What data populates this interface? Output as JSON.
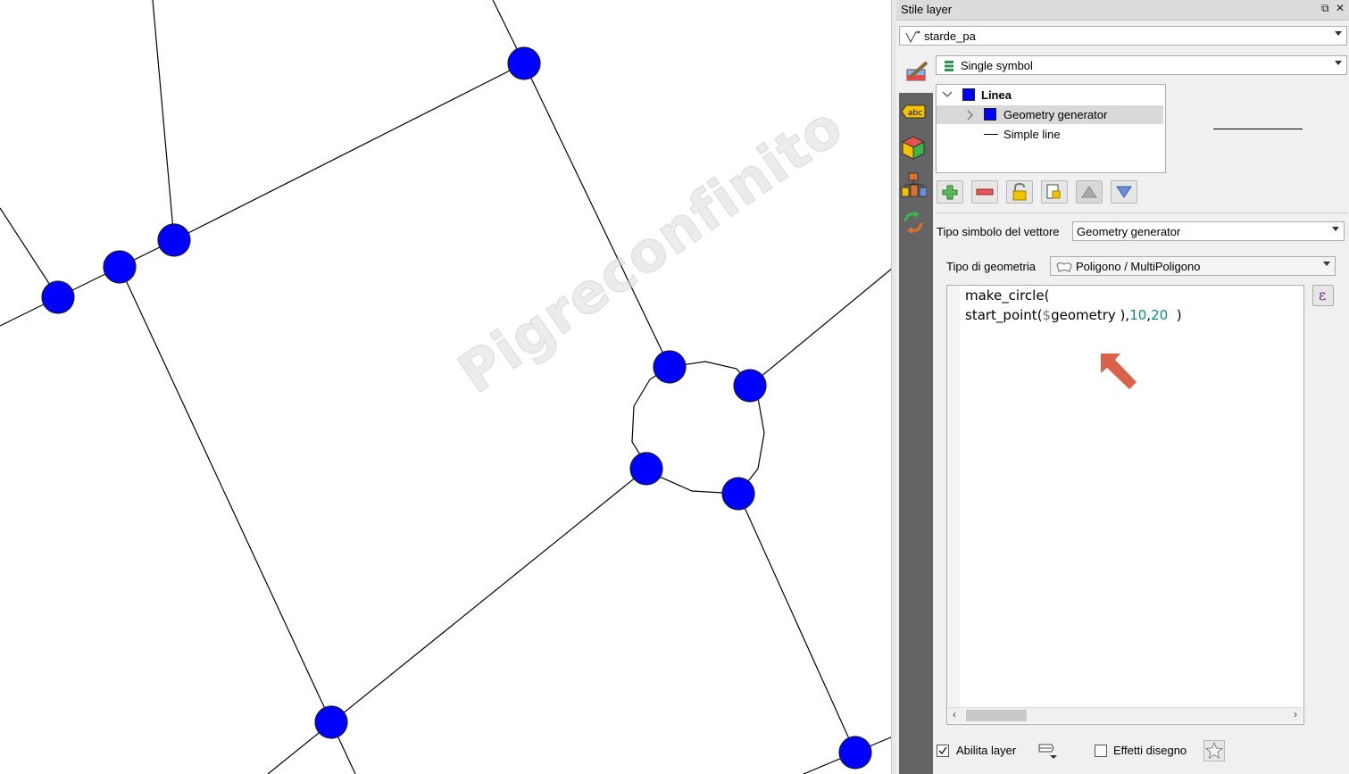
{
  "map": {
    "watermark": "Pigreconfinito",
    "line_color": "#000000",
    "node_color": "#0000ff"
  },
  "panel": {
    "title": "Stile layer",
    "float_icon": "restore-icon",
    "close_icon": "close-icon",
    "layer_combo": {
      "value": "starde_pa",
      "icon": "line-layer-icon"
    },
    "renderer_combo": {
      "value": "Single symbol",
      "icon": "single-symbol-icon"
    },
    "sidebar_icons": [
      "symbology-brush-icon",
      "labels-abc-icon",
      "3d-view-icon",
      "diagrams-icon",
      "history-icon"
    ],
    "labels_icon_text": "abc",
    "tree": {
      "root": "Linea",
      "child_1": "Geometry generator",
      "child_2": "Simple line",
      "swatch_color": "#0000ff"
    },
    "toolbar_icons": [
      "add-symbol-layer-icon",
      "remove-symbol-layer-icon",
      "lock-color-icon",
      "duplicate-symbol-layer-icon",
      "move-up-icon",
      "move-down-icon"
    ],
    "symbol_type": {
      "label": "Tipo simbolo del vettore",
      "value": "Geometry generator"
    },
    "geometry_type": {
      "label": "Tipo di geometria",
      "value": "Poligono / MultiPoligono",
      "icon": "polygon-icon"
    },
    "expression": {
      "line1": "make_circle(",
      "line2_a": "start_point(",
      "line2_var": "$",
      "line2_b": "geometry ),",
      "line2_n1": "10",
      "line2_c": ",",
      "line2_n2": "20",
      "line2_d": "  )"
    },
    "expression_button": "ε",
    "arrow_color": "#d9634a",
    "footer": {
      "enable_layer": {
        "label": "Abilita layer",
        "checked": true
      },
      "effects": {
        "label": "Effetti disegno",
        "checked": false
      }
    }
  }
}
